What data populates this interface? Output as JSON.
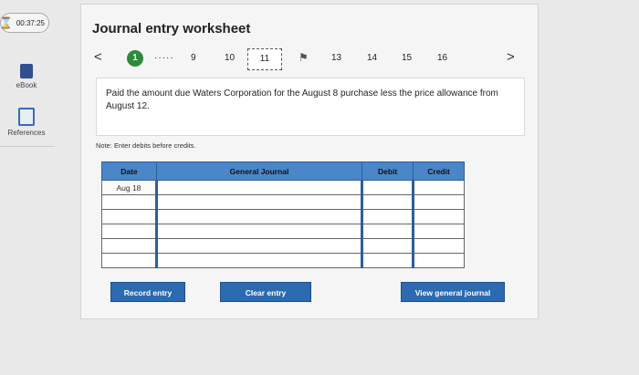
{
  "rail": {
    "timer": "00:37:25",
    "items": [
      {
        "label": "eBook",
        "icon": "book-icon"
      },
      {
        "label": "References",
        "icon": "references-icon"
      }
    ]
  },
  "header": {
    "title": "Journal entry worksheet"
  },
  "nav": {
    "prev": "<",
    "next": ">",
    "step_first": "1",
    "ellipsis": "·····",
    "steps": [
      "9",
      "10",
      "11",
      "13",
      "14",
      "15",
      "16"
    ],
    "current": "11",
    "flagged_icon": "flag-icon"
  },
  "prompt": "Paid the amount due Waters Corporation for the August 8 purchase less the price allowance from August 12.",
  "note": "Note: Enter debits before credits.",
  "journal": {
    "columns": [
      "Date",
      "General Journal",
      "Debit",
      "Credit"
    ],
    "rows": [
      {
        "date": "Aug 18",
        "account": "",
        "debit": "",
        "credit": ""
      },
      {
        "date": "",
        "account": "",
        "debit": "",
        "credit": ""
      },
      {
        "date": "",
        "account": "",
        "debit": "",
        "credit": ""
      },
      {
        "date": "",
        "account": "",
        "debit": "",
        "credit": ""
      },
      {
        "date": "",
        "account": "",
        "debit": "",
        "credit": ""
      },
      {
        "date": "",
        "account": "",
        "debit": "",
        "credit": ""
      }
    ]
  },
  "buttons": {
    "record": "Record entry",
    "clear": "Clear entry",
    "view": "View general journal"
  },
  "colors": {
    "accent": "#2c6ab1",
    "header_blue": "#4a86c8",
    "step_green": "#2e8b3a"
  }
}
